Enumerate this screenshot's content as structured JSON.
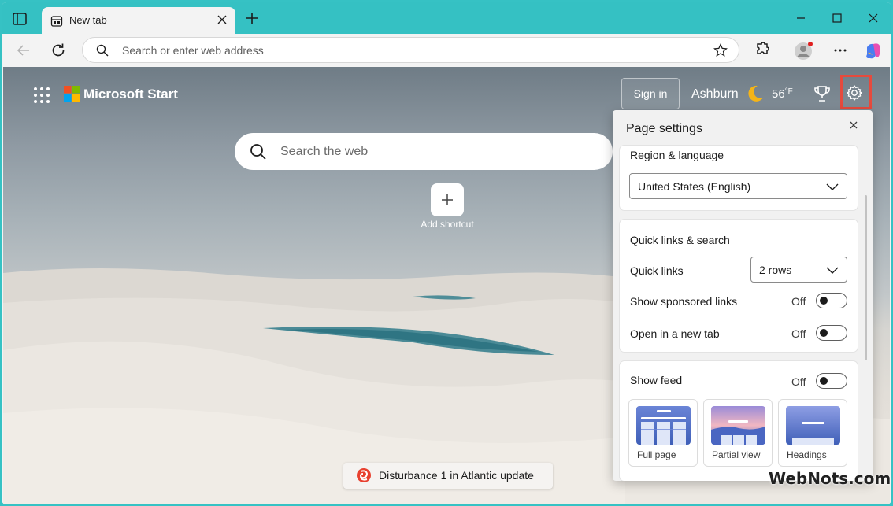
{
  "browser": {
    "tab_title": "New tab",
    "address_placeholder": "Search or enter web address"
  },
  "start": {
    "brand": "Microsoft Start",
    "sign_in": "Sign in",
    "city": "Ashburn",
    "temperature": "56",
    "temp_unit": "°F",
    "search_placeholder": "Search the web",
    "add_shortcut": "Add shortcut",
    "news_ticker": "Disturbance 1 in Atlantic update"
  },
  "settings": {
    "title": "Page settings",
    "region_label": "Region & language",
    "region_value": "United States (English)",
    "quick_section": "Quick links & search",
    "quick_links_label": "Quick links",
    "quick_links_value": "2 rows",
    "sponsored_label": "Show sponsored links",
    "sponsored_state": "Off",
    "newtab_label": "Open in a new tab",
    "newtab_state": "Off",
    "feed_label": "Show feed",
    "feed_state": "Off",
    "layouts": [
      "Full page",
      "Partial view",
      "Headings"
    ]
  },
  "watermark": "WebNots.com",
  "colors": {
    "accent_red": "#e64a3d",
    "tab_strip": "#35c1c3"
  }
}
